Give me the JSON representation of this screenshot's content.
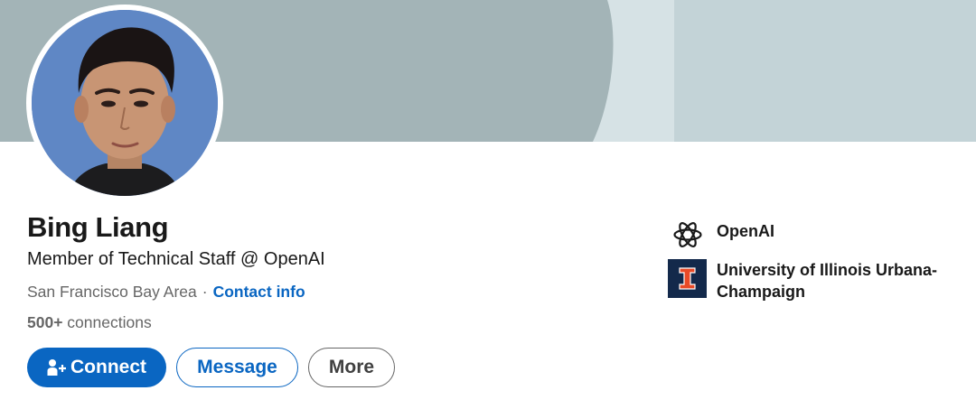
{
  "profile": {
    "name": "Bing Liang",
    "headline": "Member of Technical Staff @ OpenAI",
    "location": "San Francisco Bay Area",
    "separator": "·",
    "contact_info_label": "Contact info",
    "connections_count": "500+",
    "connections_label": "connections"
  },
  "actions": {
    "connect_label": "Connect",
    "message_label": "Message",
    "more_label": "More"
  },
  "orgs": [
    {
      "name": "OpenAI",
      "icon": "openai-logo-icon"
    },
    {
      "name": "University of Illinois Urbana-Champaign",
      "icon": "uiuc-block-i-icon"
    }
  ],
  "colors": {
    "primary_blue": "#0a66c2",
    "banner": "#a2b4b7",
    "uiuc_navy": "#13294b",
    "uiuc_orange": "#e84a27"
  }
}
